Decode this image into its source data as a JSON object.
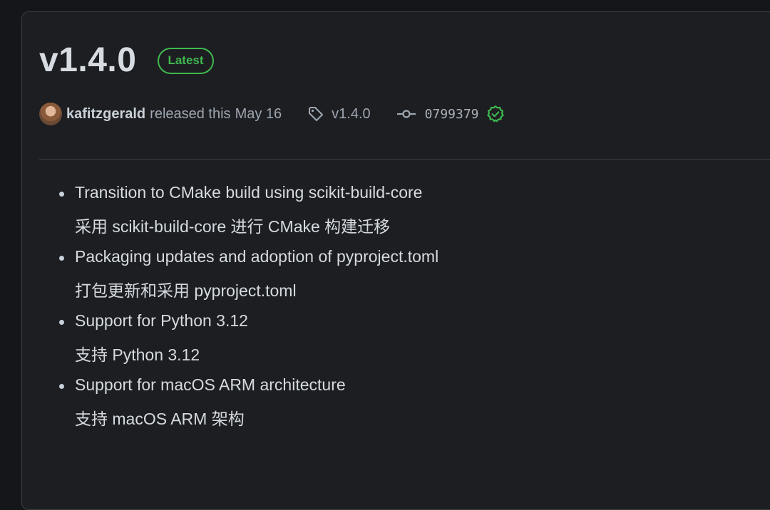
{
  "release": {
    "title": "v1.4.0",
    "badge": "Latest",
    "author": "kafitzgerald",
    "released_text": "released this",
    "date": "May 16",
    "tag": "v1.4.0",
    "commit": "0799379"
  },
  "notes": [
    {
      "en": "Transition to CMake build using scikit-build-core",
      "zh": "采用 scikit-build-core 进行 CMake 构建迁移"
    },
    {
      "en": "Packaging updates and adoption of pyproject.toml",
      "zh": "打包更新和采用 pyproject.toml"
    },
    {
      "en": "Support for Python 3.12",
      "zh": "支持 Python 3.12"
    },
    {
      "en": "Support for macOS ARM architecture",
      "zh": "支持 macOS ARM 架构"
    }
  ],
  "colors": {
    "background": "#151619",
    "card": "#1d1e21",
    "accent_green": "#3fb950",
    "text": "#d5dbe1",
    "muted": "#9ea7b3"
  },
  "icons": {
    "tag": "tag-icon",
    "commit": "git-commit-icon",
    "verified": "verified-check-icon"
  }
}
